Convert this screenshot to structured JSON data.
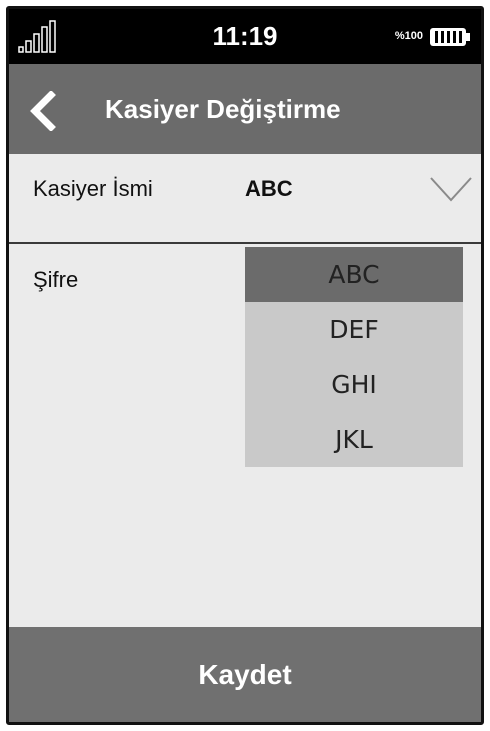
{
  "status_bar": {
    "time": "11:19",
    "battery_percent": "%100",
    "icons": [
      "signal-icon",
      "battery-icon"
    ]
  },
  "header": {
    "back_icon": "chevron-left-icon",
    "title": "Kasiyer Değiştirme"
  },
  "form": {
    "cashier_label": "Kasiyer İsmi",
    "cashier_value": "ABC",
    "password_label": "Şifre"
  },
  "dropdown": {
    "selected": "ABC",
    "options": [
      "ABC",
      "DEF",
      "GHI",
      "JKL"
    ]
  },
  "footer": {
    "save_label": "Kaydet"
  },
  "colors": {
    "status_bar": "#000000",
    "header": "#6b6b6b",
    "background": "#ebebeb",
    "dropdown_bg": "#c9c9c9",
    "dropdown_selected": "#6b6b6b",
    "save_button": "#707070"
  }
}
